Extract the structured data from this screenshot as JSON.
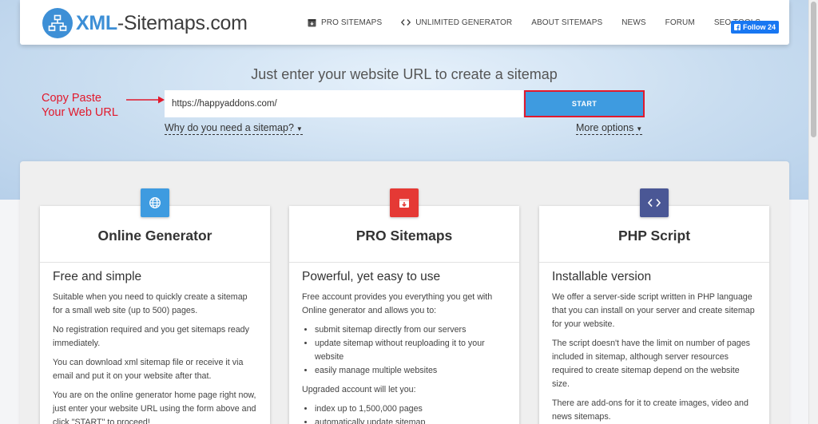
{
  "logo": {
    "brand_bold": "XML",
    "brand_rest": "-Sitemaps.com",
    "icon": "sitemap-icon"
  },
  "nav": [
    {
      "label": "PRO SITEMAPS",
      "icon": "box-icon"
    },
    {
      "label": "UNLIMITED GENERATOR",
      "icon": "code-icon"
    },
    {
      "label": "ABOUT SITEMAPS",
      "icon": ""
    },
    {
      "label": "NEWS",
      "icon": ""
    },
    {
      "label": "FORUM",
      "icon": ""
    },
    {
      "label": "SEO TOOLS",
      "icon": ""
    }
  ],
  "follow": {
    "label": "Follow 24"
  },
  "hero": {
    "title": "Just enter your website URL to create a sitemap",
    "url_value": "https://happyaddons.com/",
    "start_label": "START",
    "why_link": "Why do you need a sitemap?",
    "more_link": "More options"
  },
  "annotation": {
    "line1": "Copy Paste",
    "line2": "Your Web URL",
    "color": "#e2192c"
  },
  "colors": {
    "accent": "#3d8fd6",
    "start": "#3e9be0",
    "pro": "#e53935",
    "php": "#4a5795"
  },
  "cards": [
    {
      "title": "Online Generator",
      "icon": "globe-icon",
      "subtitle": "Free and simple",
      "paragraphs": [
        "Suitable when you need to quickly create a sitemap for a small web site (up to 500) pages.",
        "No registration required and you get sitemaps ready immediately.",
        "You can download xml sitemap file or receive it via email and put it on your website after that.",
        "You are on the online generator home page right now, just enter your website URL using the form above and click \"START\" to proceed!"
      ]
    },
    {
      "title": "PRO Sitemaps",
      "icon": "box-icon",
      "subtitle": "Powerful, yet easy to use",
      "intro": "Free account provides you everything you get with Online generator and allows you to:",
      "list1": [
        "submit sitemap directly from our servers",
        "update sitemap without reuploading it to your website",
        "easily manage multiple websites"
      ],
      "mid": "Upgraded account will let you:",
      "list2": [
        "index up to 1,500,000 pages",
        "automatically update sitemap"
      ]
    },
    {
      "title": "PHP Script",
      "icon": "code-icon",
      "subtitle": "Installable version",
      "paragraphs": [
        "We offer a server-side script written in PHP language that you can install on your server and create sitemap for your website.",
        "The script doesn't have the limit on number of pages included in sitemap, although server resources required to create sitemap depend on the website size.",
        "There are add-ons for it to create images, video and news sitemaps."
      ]
    }
  ]
}
